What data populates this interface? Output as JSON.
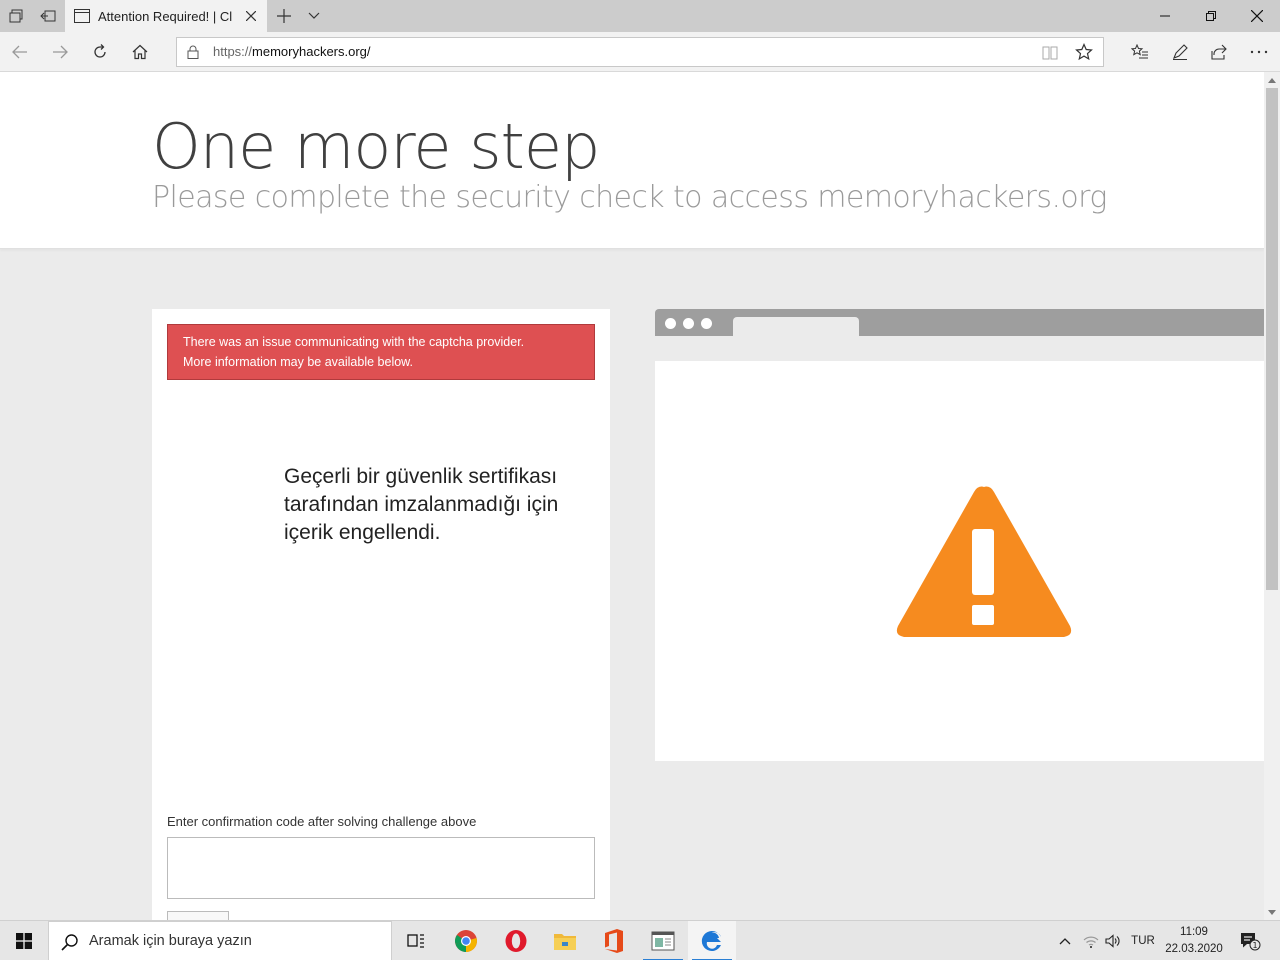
{
  "browser": {
    "tab_title": "Attention Required! | Cl",
    "url_scheme": "https://",
    "url_host": "memoryhackers.org/"
  },
  "hero": {
    "title": "One more step",
    "subtitle": "Please complete the security check to access memoryhackers.org"
  },
  "card": {
    "alert_line1": "There was an issue communicating with the captcha provider.",
    "alert_line2": "More information may be available below.",
    "blocked_message": "Geçerli bir güvenlik sertifikası tarafından imzalanmadığı için içerik engellendi.",
    "code_label": "Enter confirmation code after solving challenge above",
    "code_value": ""
  },
  "illustration": {
    "warning_color": "#f68b1f",
    "bar_color": "#9e9e9e",
    "icon": "warning-triangle-icon"
  },
  "taskbar": {
    "search_placeholder": "Aramak için buraya yazın",
    "apps": [
      "task-view-icon",
      "chrome-icon",
      "opera-icon",
      "file-explorer-icon",
      "office-icon",
      "app-window-icon",
      "edge-icon"
    ],
    "language": "TUR",
    "time": "11:09",
    "date": "22.03.2020",
    "notification_count": "1"
  },
  "colors": {
    "alert_bg": "#de5052",
    "accent": "#2a7fd4"
  }
}
